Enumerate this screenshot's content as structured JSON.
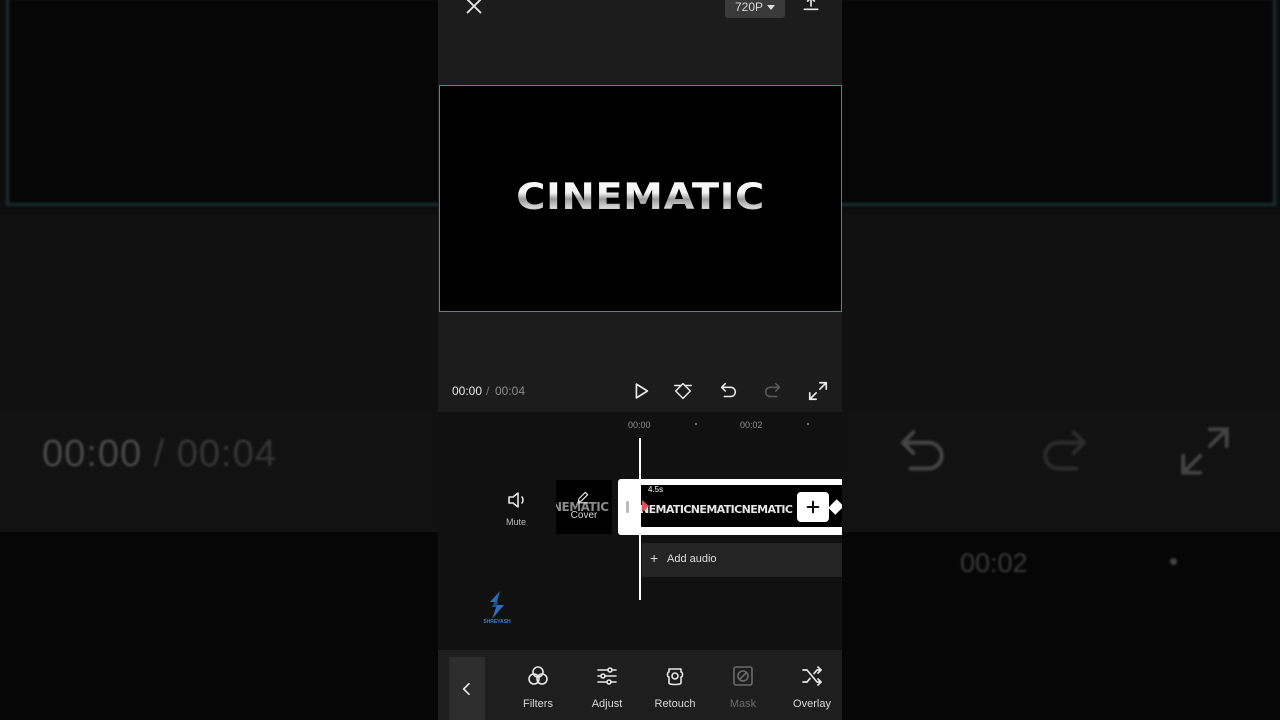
{
  "app": {
    "resolution": "720P",
    "preview_text": "CINEMATIC",
    "time_current": "00:00",
    "time_separator": "/",
    "time_total": "00:04"
  },
  "timeline": {
    "ruler": [
      "00:00",
      "00:02"
    ],
    "mute_label": "Mute",
    "cover_label": "Cover",
    "cover_thumb_text": "NEMATIC",
    "clip_duration": "4.5s",
    "clip_frames_text": "NEMATICNEMATICNEMATIC",
    "add_audio_label": "Add audio",
    "add_audio_plus": "+"
  },
  "watermark": {
    "text": "SHREYASH"
  },
  "toolbar": {
    "tools": [
      {
        "label": "Filters",
        "icon": "filters-icon",
        "enabled": true
      },
      {
        "label": "Adjust",
        "icon": "adjust-icon",
        "enabled": true
      },
      {
        "label": "Retouch",
        "icon": "retouch-icon",
        "enabled": true
      },
      {
        "label": "Mask",
        "icon": "mask-icon",
        "enabled": false
      },
      {
        "label": "Overlay",
        "icon": "overlay-icon",
        "enabled": true
      }
    ]
  },
  "background": {
    "time_current": "00:00",
    "time_separator": "/",
    "time_total": "00:04",
    "ruler_label": "00:02"
  },
  "colors": {
    "accent_border": "#4d8a86",
    "clip_marker": "#e0505c",
    "panel": "#1c1c1c"
  }
}
